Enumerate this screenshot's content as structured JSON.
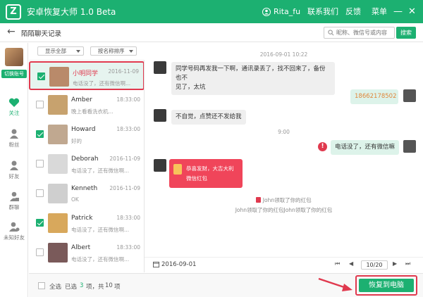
{
  "app": {
    "title": "安卓恢复大师 1.0 Beta",
    "user": "Rita_fu",
    "contact_us": "联系我们",
    "feedback": "反馈",
    "menu": "菜单"
  },
  "nav": {
    "page_title": "陌陌聊天记录",
    "search_placeholder": "昵称、微信号或内容",
    "search_button": "搜索"
  },
  "sidebar": {
    "switch_account": "切换账号",
    "items": [
      {
        "label": "关注",
        "icon": "heart-icon"
      },
      {
        "label": "粉丝",
        "icon": "person-icon"
      },
      {
        "label": "好友",
        "icon": "person-icon"
      },
      {
        "label": "群聊",
        "icon": "group-icon"
      },
      {
        "label": "未知好友",
        "icon": "unknown-person-icon"
      }
    ]
  },
  "filters": {
    "show": "显示全部",
    "sort": "按名称排序"
  },
  "contacts": [
    {
      "name": "小明同学",
      "date": "2016-11-09",
      "msg": "电话没了，还有微信啊...",
      "checked": true,
      "selected": true,
      "avatar": "#b98a6a"
    },
    {
      "name": "Amber",
      "date": "18:33:00",
      "msg": "晚上看看洗衣机...",
      "checked": false,
      "selected": false,
      "avatar": "#c7a26e"
    },
    {
      "name": "Howard",
      "date": "18:33:00",
      "msg": "好的",
      "checked": true,
      "selected": false,
      "avatar": "#c0a890"
    },
    {
      "name": "Deborah",
      "date": "2016-11-09",
      "msg": "电话没了，还有微信啊...",
      "checked": false,
      "selected": false,
      "avatar": "#d9d9d9"
    },
    {
      "name": "Kenneth",
      "date": "2016-11-09",
      "msg": "OK",
      "checked": false,
      "selected": false,
      "avatar": "#cfcfcf"
    },
    {
      "name": "Patrick",
      "date": "18:33:00",
      "msg": "电话没了，还有微信啊...",
      "checked": true,
      "selected": false,
      "avatar": "#d8a85c"
    },
    {
      "name": "Albert",
      "date": "18:33:00",
      "msg": "电话没了，还有微信啊...",
      "checked": false,
      "selected": false,
      "avatar": "#7a5a5a"
    }
  ],
  "chat": {
    "timestamp1": "2016-09-01 10:22",
    "msg1": "同学号码再发我一下啊，通讯录丢了，找不回来了，备份也不",
    "msg1b": "见了，太坑",
    "phone": "18662178502",
    "msg2": "不自觉，点赞还不发给我",
    "timestamp2": "9:00",
    "msg3": "电话没了，还有微信嘛",
    "redpacket_line1": "恭喜发财，大吉大利",
    "redpacket_line2": "微信红包",
    "note1": "John领取了你的红包",
    "note2": "John领取了你的红包John领取了你的红包",
    "date": "2016-09-01",
    "page": "10/20"
  },
  "bottom": {
    "select_all": "全选",
    "selected_prefix": "已选",
    "selected_count": "3",
    "selected_mid": "项，共",
    "total": "10",
    "selected_suffix": "项",
    "restore": "恢复到电脑"
  },
  "colors": {
    "accent": "#1cb071",
    "highlight": "#e0394e"
  }
}
